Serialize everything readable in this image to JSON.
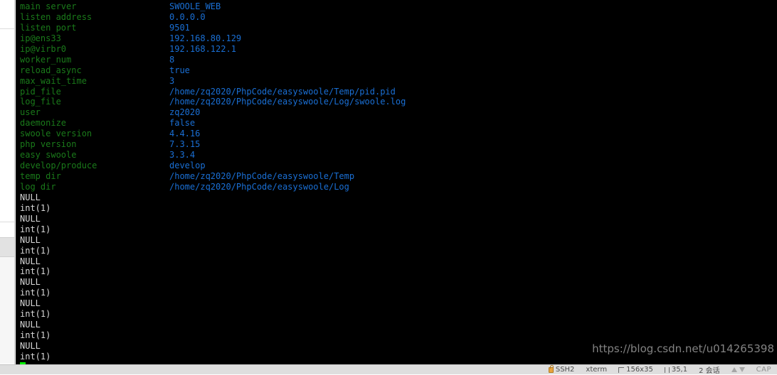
{
  "terminal": {
    "config_rows": [
      {
        "key": "main server",
        "value": "SWOOLE_WEB"
      },
      {
        "key": "listen address",
        "value": "0.0.0.0"
      },
      {
        "key": "listen port",
        "value": "9501"
      },
      {
        "key": "ip@ens33",
        "value": "192.168.80.129"
      },
      {
        "key": "ip@virbr0",
        "value": "192.168.122.1"
      },
      {
        "key": "worker_num",
        "value": "8"
      },
      {
        "key": "reload_async",
        "value": "true"
      },
      {
        "key": "max_wait_time",
        "value": "3"
      },
      {
        "key": "pid_file",
        "value": "/home/zq2020/PhpCode/easyswoole/Temp/pid.pid"
      },
      {
        "key": "log_file",
        "value": "/home/zq2020/PhpCode/easyswoole/Log/swoole.log"
      },
      {
        "key": "user",
        "value": "zq2020"
      },
      {
        "key": "daemonize",
        "value": "false"
      },
      {
        "key": "swoole version",
        "value": "4.4.16"
      },
      {
        "key": "php version",
        "value": "7.3.15"
      },
      {
        "key": "easy swoole",
        "value": "3.3.4"
      },
      {
        "key": "develop/produce",
        "value": "develop"
      },
      {
        "key": "temp dir",
        "value": "/home/zq2020/PhpCode/easyswoole/Temp"
      },
      {
        "key": "log dir",
        "value": "/home/zq2020/PhpCode/easyswoole/Log"
      }
    ],
    "output_lines": [
      "NULL",
      "int(1)",
      "NULL",
      "int(1)",
      "NULL",
      "int(1)",
      "NULL",
      "int(1)",
      "NULL",
      "int(1)",
      "NULL",
      "int(1)",
      "NULL",
      "int(1)",
      "NULL",
      "int(1)"
    ],
    "colors": {
      "background": "#000000",
      "key": "#1a7a1a",
      "value": "#1a6fd4",
      "output": "#d8d8d8",
      "cursor": "#00ef00"
    }
  },
  "watermark": {
    "text": "https://blog.csdn.net/u014265398"
  },
  "statusbar": {
    "protocol": "SSH2",
    "emulation": "xterm",
    "size": "156x35",
    "cursor_pos": "35,1",
    "sessions": "2 会话",
    "caps": "CAP"
  }
}
